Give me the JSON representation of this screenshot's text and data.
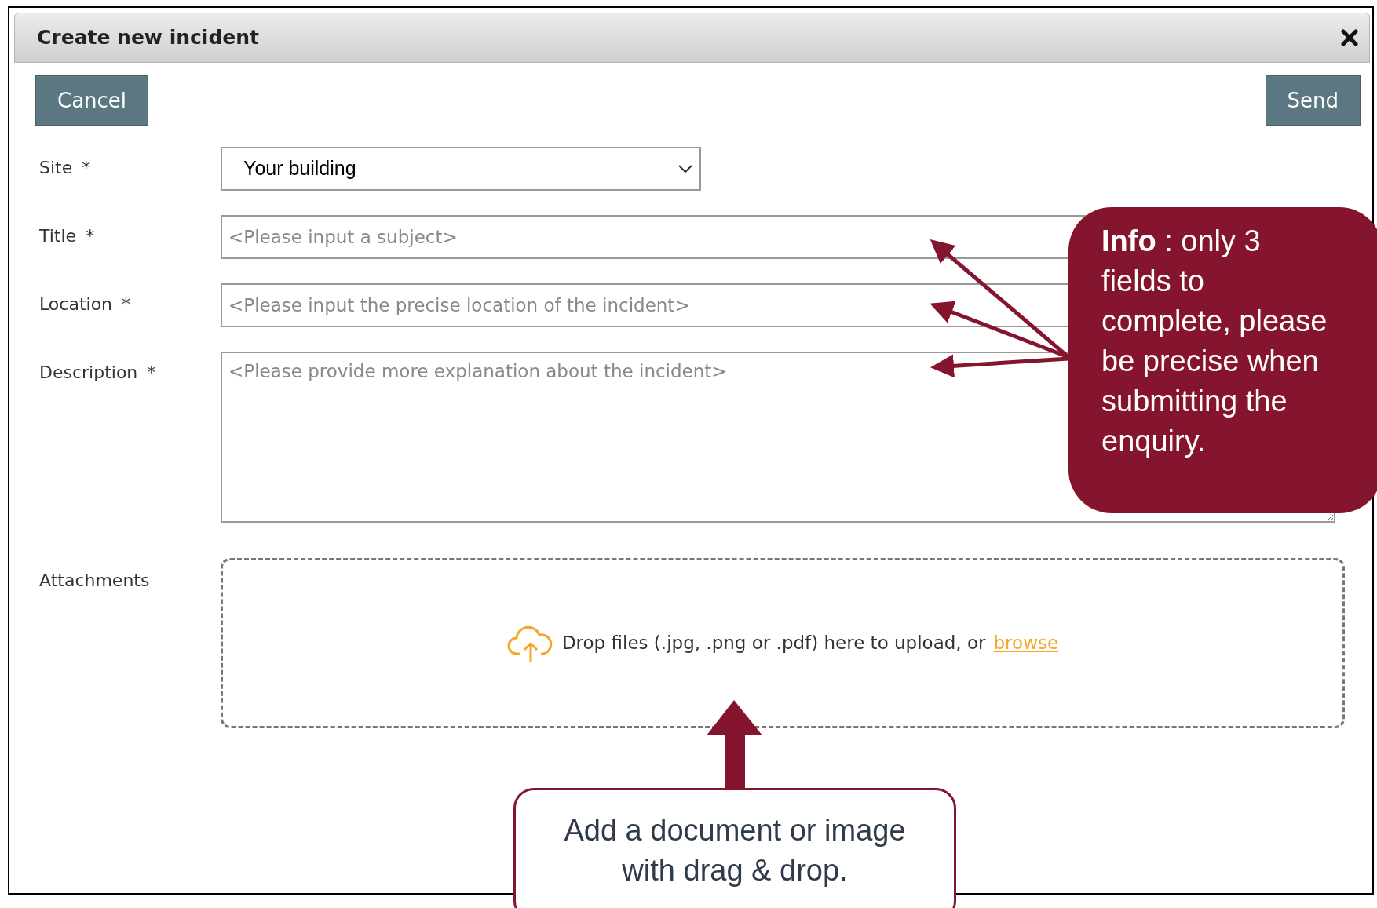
{
  "dialog": {
    "title": "Create new incident"
  },
  "buttons": [
    {
      "kind": "cancel",
      "label": "Cancel"
    },
    {
      "kind": "send",
      "label": "Send"
    }
  ],
  "fields": [
    {
      "kind": "select",
      "label": "Site",
      "required_mark": "*",
      "value": "Your building"
    },
    {
      "kind": "input",
      "label": "Title",
      "required_mark": "*",
      "placeholder": "<Please input a subject>"
    },
    {
      "kind": "input",
      "label": "Location",
      "required_mark": "*",
      "placeholder": "<Please input the precise location of the incident>"
    },
    {
      "kind": "textarea",
      "label": "Description",
      "required_mark": "*",
      "placeholder": "<Please provide more explanation about the incident>"
    }
  ],
  "attachments": {
    "label": "Attachments",
    "drop_text": "Drop files (.jpg, .png or .pdf) here to upload, or",
    "link": "browse"
  },
  "callouts": [
    {
      "kind": "info",
      "text": "**Info** : only 3 fields to complete, please be precise when submitting the enquiry."
    },
    {
      "kind": "note",
      "text": "Add a document or image with drag & drop."
    }
  ]
}
